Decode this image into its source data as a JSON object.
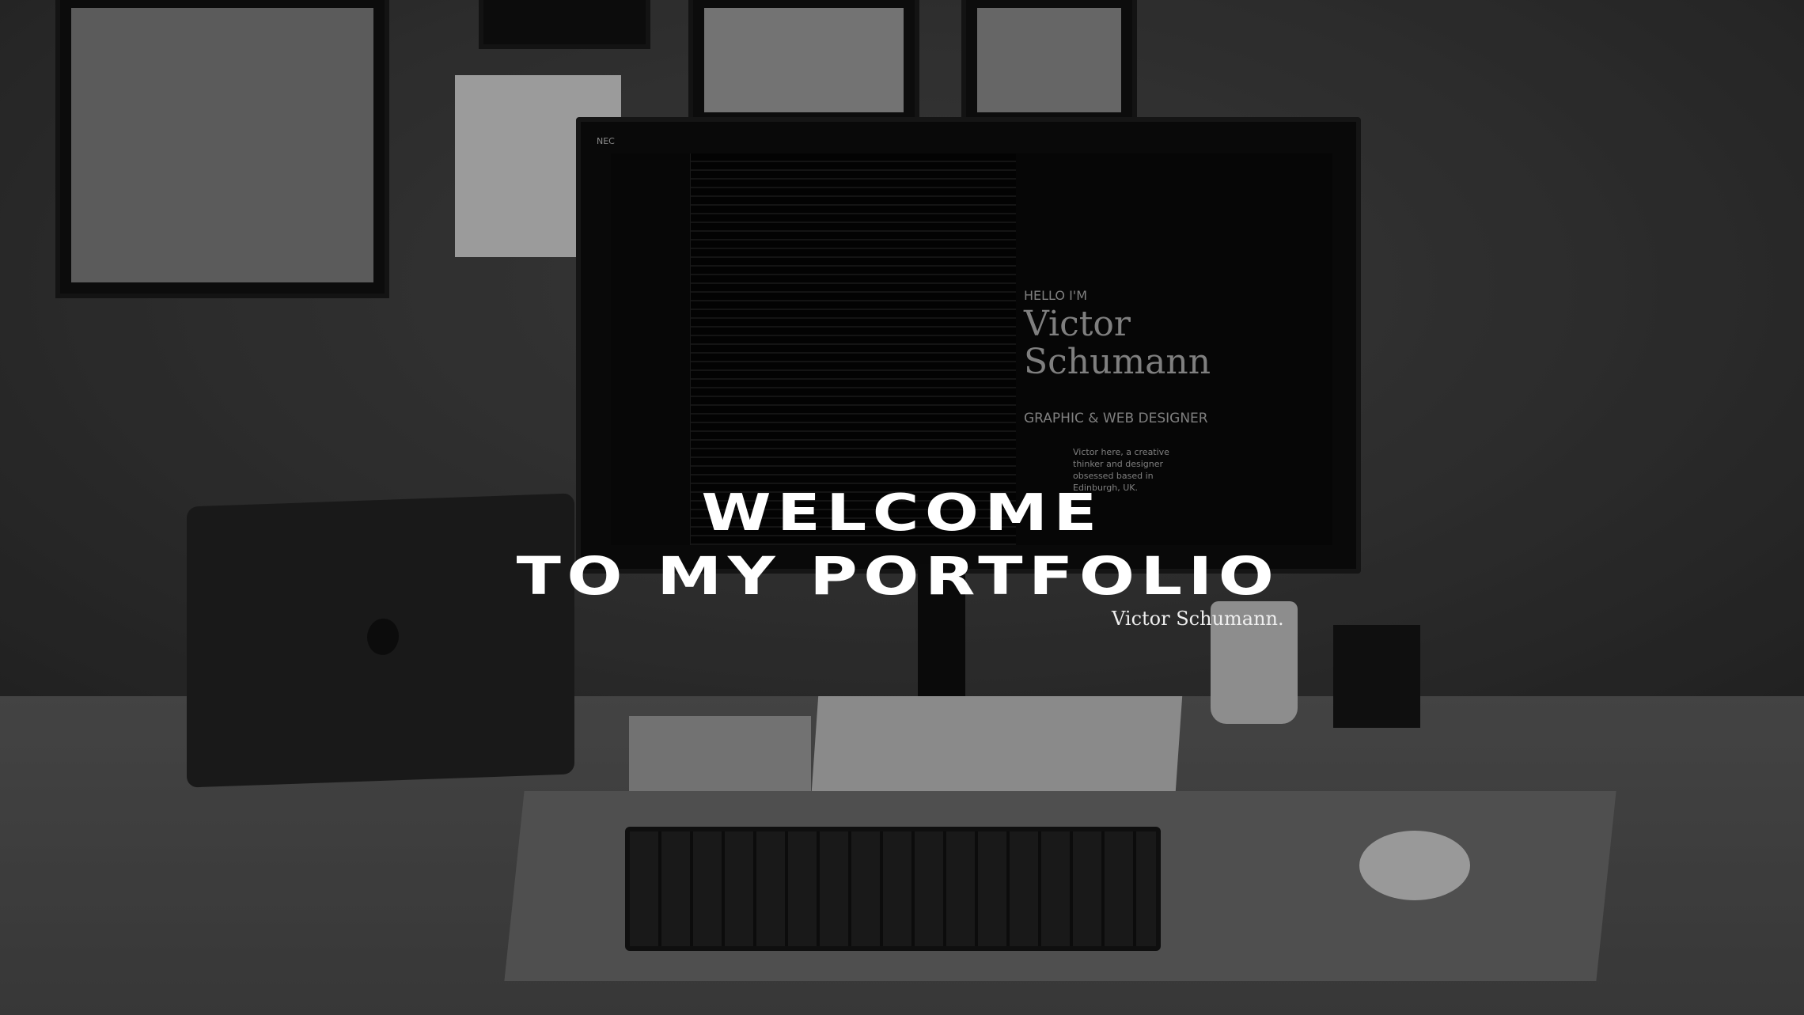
{
  "hero": {
    "title_line1": "WELCOME",
    "title_line2": "TO MY PORTFOLIO",
    "signature": "Victor Schumann."
  },
  "monitor_screen": {
    "brand": "NEC",
    "greeting": "HELLO I'M",
    "name_line1": "Victor",
    "name_line2": "Schumann",
    "role": "GRAPHIC & WEB DESIGNER",
    "bio": "Victor here, a creative thinker and designer obsessed based in Edinburgh, UK."
  },
  "colors": {
    "text": "#ffffff",
    "background": "#3a3a3a"
  }
}
